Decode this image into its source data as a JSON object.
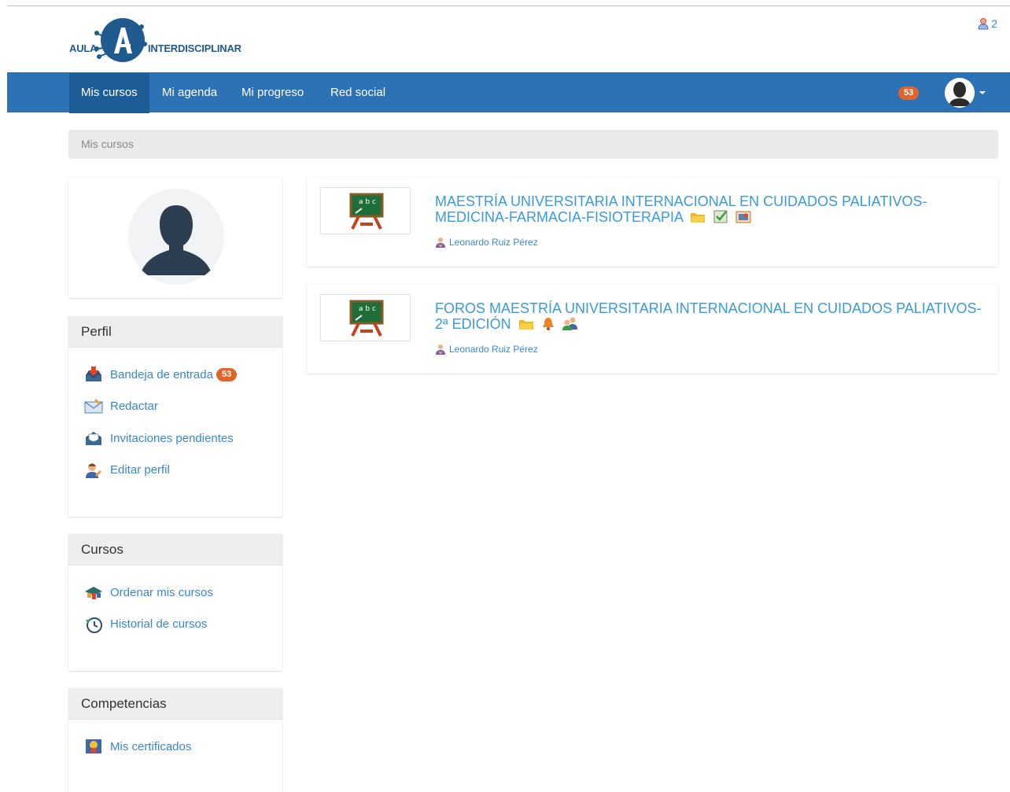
{
  "header": {
    "logo_left": "AULA",
    "logo_right": "INTERDISCIPLINAR",
    "online_count": "2",
    "online_icon": "users-online-icon"
  },
  "nav": {
    "items": [
      {
        "label": "Mis cursos",
        "active": true
      },
      {
        "label": "Mi agenda",
        "active": false
      },
      {
        "label": "Mi progreso",
        "active": false
      },
      {
        "label": "Red social",
        "active": false
      }
    ],
    "notifications": "53",
    "accent": "#2c72b4",
    "active_color": "#1d5d97",
    "badge_color": "#e0642c"
  },
  "breadcrumb": "Mis cursos",
  "sidebar": {
    "profile": {
      "title": "Perfil",
      "items": [
        {
          "label": "Bandeja de entrada",
          "icon": "inbox-icon",
          "badge": "53"
        },
        {
          "label": "Redactar",
          "icon": "compose-mail-icon"
        },
        {
          "label": "Invitaciones pendientes",
          "icon": "invitations-icon"
        },
        {
          "label": "Editar perfil",
          "icon": "edit-profile-icon"
        }
      ]
    },
    "courses": {
      "title": "Cursos",
      "items": [
        {
          "label": "Ordenar mis cursos",
          "icon": "sort-courses-icon"
        },
        {
          "label": "Historial de cursos",
          "icon": "course-history-icon"
        }
      ]
    },
    "skills": {
      "title": "Competencias",
      "items": [
        {
          "label": "Mis certificados",
          "icon": "certificate-icon"
        }
      ]
    }
  },
  "courses": [
    {
      "title": "MAESTRÍA UNIVERSITARIA INTERNACIONAL EN CUIDADOS PALIATIVOS-MEDICINA-FARMACIA-FISIOTERAPIA",
      "teacher": "Leonardo Ruiz Pérez",
      "icons": [
        "folder-icon",
        "exercise-icon",
        "announcement-icon"
      ]
    },
    {
      "title": "FOROS MAESTRÍA UNIVERSITARIA INTERNACIONAL EN CUIDADOS PALIATIVOS-2ª EDICIÓN",
      "teacher": "Leonardo Ruiz Pérez",
      "icons": [
        "folder-icon",
        "notification-bell-icon",
        "group-icon"
      ]
    }
  ]
}
